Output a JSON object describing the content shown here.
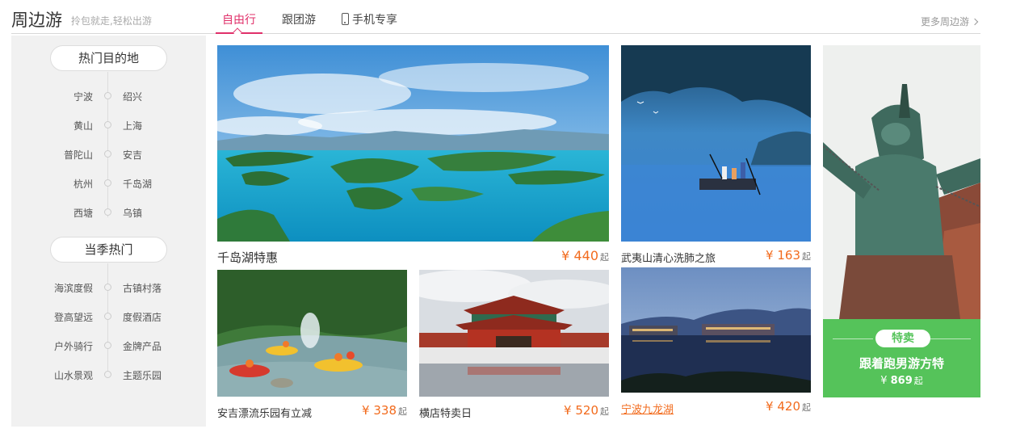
{
  "header": {
    "title": "周边游",
    "subtitle": "拎包就走,轻松出游",
    "tabs": [
      {
        "label": "自由行",
        "active": true
      },
      {
        "label": "跟团游",
        "active": false
      },
      {
        "label": "手机专享",
        "active": false,
        "icon": "phone-icon"
      }
    ],
    "more_label": "更多周边游"
  },
  "sidebar": {
    "sections": [
      {
        "title": "热门目的地",
        "rows": [
          [
            "宁波",
            "绍兴"
          ],
          [
            "黄山",
            "上海"
          ],
          [
            "普陀山",
            "安吉"
          ],
          [
            "杭州",
            "千岛湖"
          ],
          [
            "西塘",
            "乌镇"
          ]
        ]
      },
      {
        "title": "当季热门",
        "rows": [
          [
            "海滨度假",
            "古镇村落"
          ],
          [
            "登高望远",
            "度假酒店"
          ],
          [
            "户外骑行",
            "金牌产品"
          ],
          [
            "山水景观",
            "主题乐园"
          ]
        ]
      }
    ]
  },
  "cards": [
    {
      "name": "千岛湖特惠",
      "currency": "¥",
      "price": "440",
      "suffix": "起"
    },
    {
      "name": "武夷山清心洗肺之旅",
      "currency": "¥",
      "price": "163",
      "suffix": "起"
    },
    {
      "name": "安吉漂流乐园有立减",
      "currency": "¥",
      "price": "338",
      "suffix": "起"
    },
    {
      "name": "横店特卖日",
      "currency": "¥",
      "price": "520",
      "suffix": "起"
    },
    {
      "name": "宁波九龙湖",
      "currency": "¥",
      "price": "420",
      "suffix": "起"
    }
  ],
  "promo": {
    "badge": "特卖",
    "title": "跟着跑男游方特",
    "currency": "¥",
    "price": "869",
    "suffix": "起"
  },
  "colors": {
    "accent": "#e0306a",
    "price": "#f26b1d",
    "promo": "#55c35a"
  }
}
